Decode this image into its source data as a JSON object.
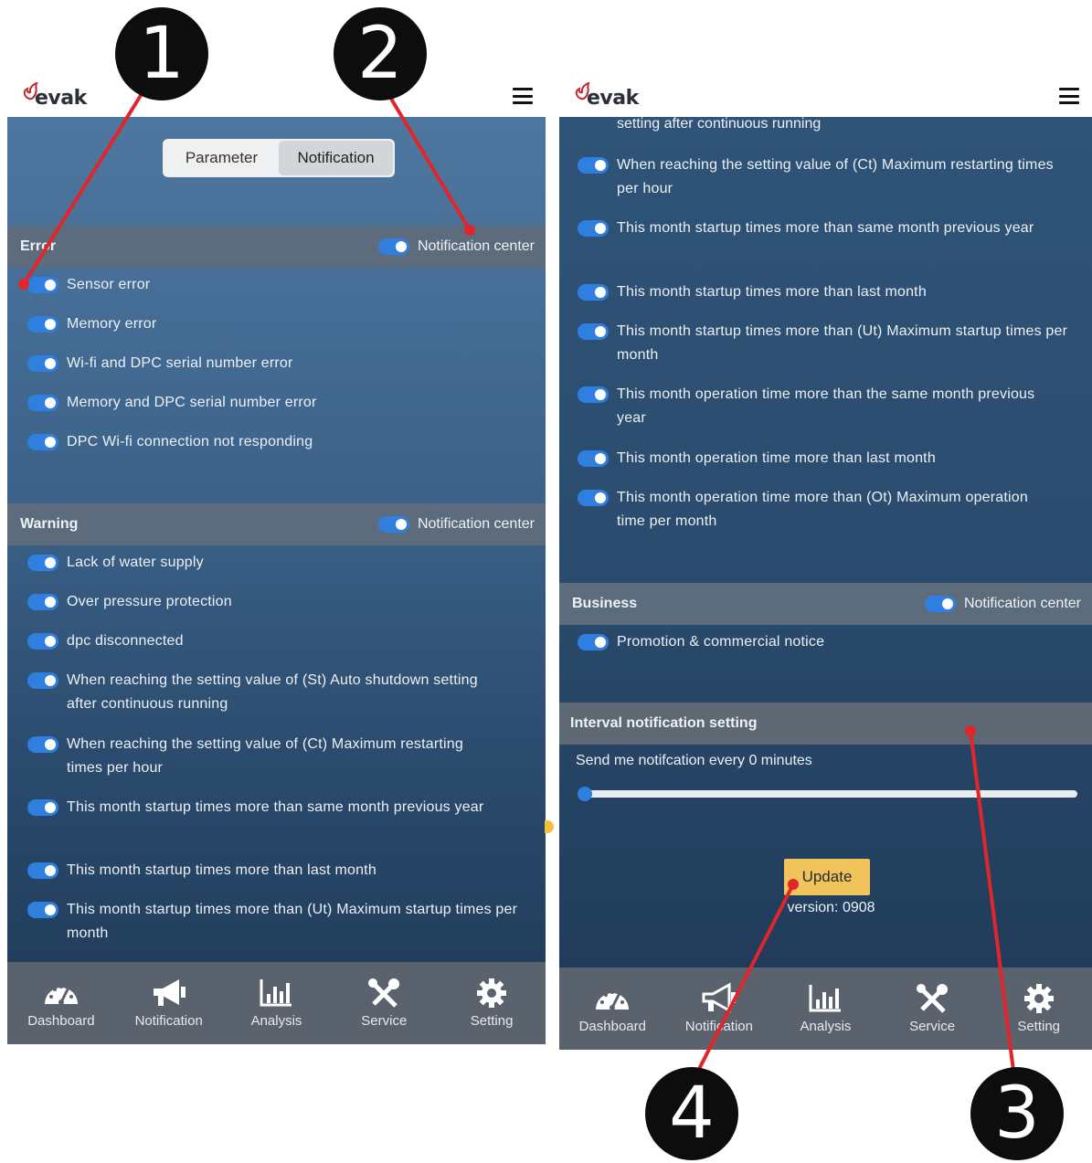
{
  "brand": {
    "wordmark": "evak",
    "logo_icon": "evak-flame-logo-icon",
    "accent_color": "#c0262d"
  },
  "toggle_color": "#2f7fe0",
  "left_screen": {
    "tabs": [
      {
        "label": "Parameter",
        "active": false
      },
      {
        "label": "Notification",
        "active": true
      }
    ],
    "error_section": {
      "title": "Error",
      "notification_center": "Notification center",
      "items": [
        "Sensor error",
        "Memory error",
        "Wi-fi and DPC serial number error",
        "Memory and DPC serial number error",
        "DPC Wi-fi connection not responding"
      ]
    },
    "warning_section": {
      "title": "Warning",
      "notification_center": "Notification center",
      "items": [
        "Lack of water supply",
        "Over pressure protection",
        "dpc disconnected",
        "When reaching the setting value of (St) Auto shutdown setting after continuous running",
        "When reaching the setting value of (Ct) Maximum restarting times per hour",
        "This month startup times more than same month previous year",
        "This month startup times more than last month",
        "This month startup times more than (Ut) Maximum startup times per month"
      ]
    }
  },
  "right_screen": {
    "warning_continued": {
      "carry_text": "setting after continuous running",
      "items": [
        "When reaching the setting value of (Ct) Maximum restarting times per hour",
        "This month startup times more than same month previous year",
        "This month startup times more than last month",
        "This month startup times more than (Ut) Maximum startup times per month",
        "This month operation time more than the same month previous year",
        "This month operation time more than last month",
        "This month operation time more than (Ot) Maximum operation time per month"
      ]
    },
    "business_section": {
      "title": "Business",
      "notification_center": "Notification center",
      "items": [
        "Promotion & commercial notice"
      ]
    },
    "interval_section": {
      "title": "Interval notification setting",
      "text": "Send me notifcation every 0 minutes",
      "slider_value": 0
    },
    "update_button": "Update",
    "version": "version: 0908"
  },
  "bottom_nav": [
    {
      "label": "Dashboard",
      "icon": "speedometer-icon"
    },
    {
      "label": "Notification",
      "icon": "megaphone-icon"
    },
    {
      "label": "Analysis",
      "icon": "bar-chart-icon"
    },
    {
      "label": "Service",
      "icon": "tools-icon"
    },
    {
      "label": "Setting",
      "icon": "gear-icon"
    }
  ],
  "annotations": {
    "callouts": [
      "1",
      "2",
      "3",
      "4"
    ],
    "callout_color": "#0d0d0d",
    "leader_color": "#e0262b"
  }
}
